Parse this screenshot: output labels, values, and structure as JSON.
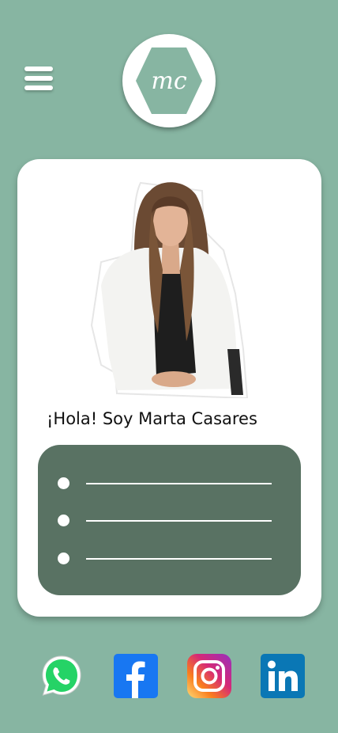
{
  "header": {
    "menu_icon": "hamburger-menu-icon",
    "logo_text": "mc"
  },
  "profile": {
    "greeting": "¡Hola! Soy Marta Casares",
    "photo": "profile-photo"
  },
  "content_list": {
    "item_count": 3
  },
  "social_links": [
    {
      "name": "WhatsApp",
      "icon": "whatsapp-icon",
      "color": "#25d366"
    },
    {
      "name": "Facebook",
      "icon": "facebook-icon",
      "color": "#1877f2"
    },
    {
      "name": "Instagram",
      "icon": "instagram-icon",
      "color": "#e1306c"
    },
    {
      "name": "LinkedIn",
      "icon": "linkedin-icon",
      "color": "#0a77b5"
    }
  ],
  "colors": {
    "background": "#87b5a2",
    "accent": "#597263",
    "logo_hexagon": "#87b5a2"
  }
}
